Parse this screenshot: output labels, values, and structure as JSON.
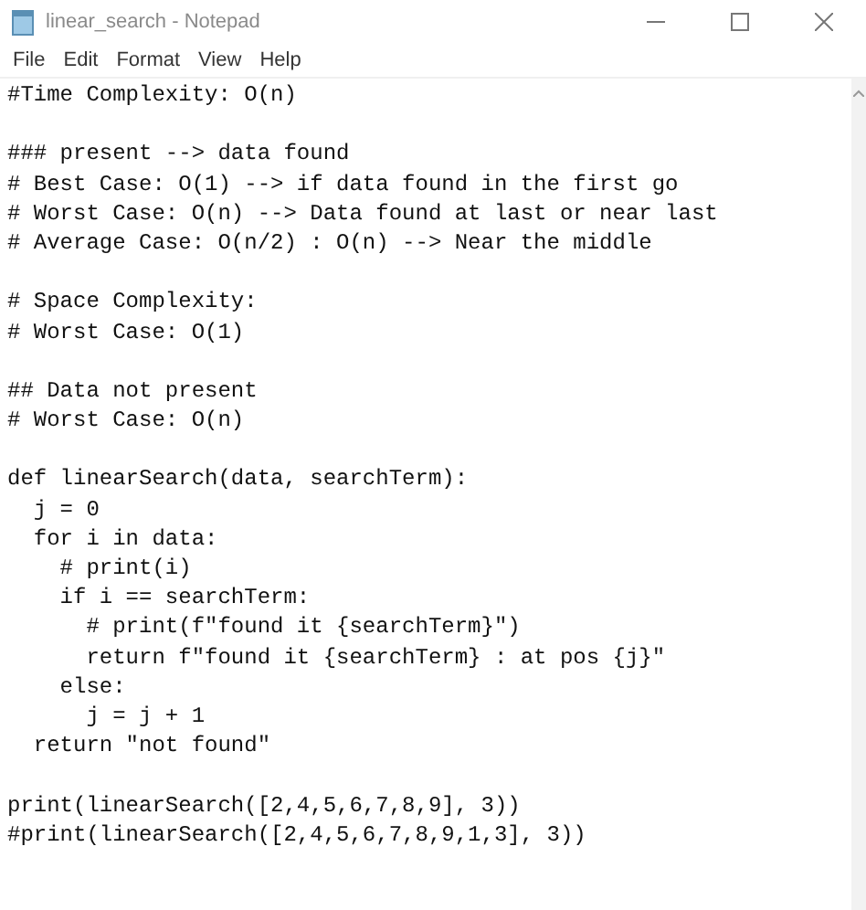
{
  "window": {
    "title": "linear_search - Notepad"
  },
  "menu": [
    "File",
    "Edit",
    "Format",
    "View",
    "Help"
  ],
  "editor": {
    "blocks": [
      [
        "#Time Complexity: O(n)"
      ],
      [
        "### present --> data found",
        "# Best Case: O(1) --> if data found in the first go",
        "# Worst Case: O(n) --> Data found at last or near last",
        "# Average Case: O(n/2) : O(n) --> Near the middle"
      ],
      [
        "# Space Complexity:",
        "# Worst Case: O(1)"
      ],
      [
        "## Data not present",
        "# Worst Case: O(n)"
      ],
      [
        "def linearSearch(data, searchTerm):",
        "  j = 0",
        "  for i in data:",
        "    # print(i)",
        "    if i == searchTerm:",
        "      # print(f\"found it {searchTerm}\")",
        "      return f\"found it {searchTerm} : at pos {j}\"",
        "    else:",
        "      j = j + 1",
        "  return \"not found\""
      ],
      [
        "print(linearSearch([2,4,5,6,7,8,9], 3))",
        "#print(linearSearch([2,4,5,6,7,8,9,1,3], 3))"
      ]
    ]
  }
}
